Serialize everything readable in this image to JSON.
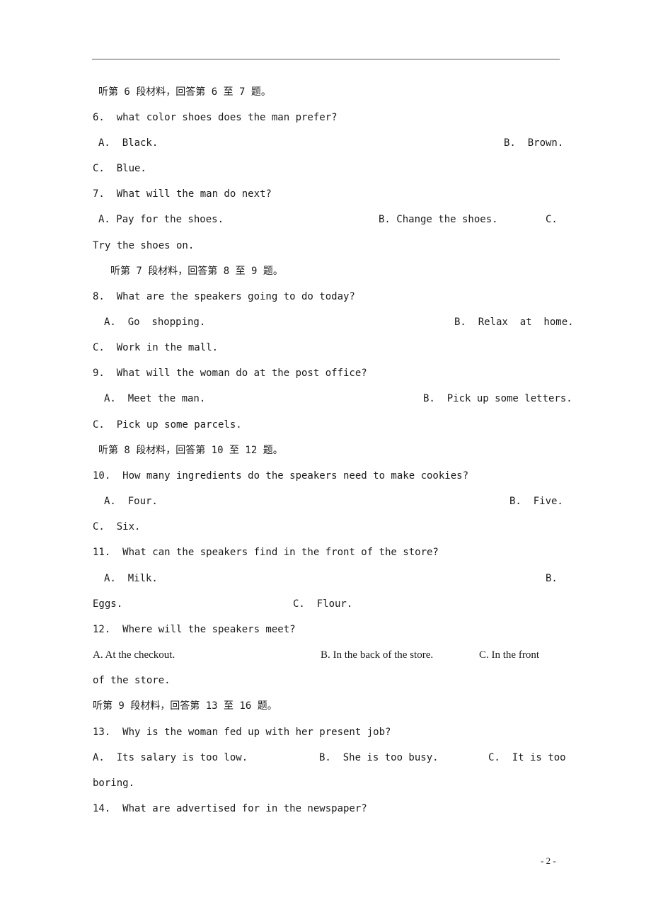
{
  "page": {
    "page_number": "- 2 -",
    "lines": [
      {
        "text": "听第 6 段材料，回答第 6 至 7 题。"
      },
      {
        "text": "6.  what color shoes does the man prefer?"
      },
      {
        "text": "A.  Black."
      },
      {
        "text": "B.  Brown."
      },
      {
        "text": "C.  Blue."
      },
      {
        "text": "7.  What will the man do next?"
      },
      {
        "text": "A. Pay for the shoes."
      },
      {
        "text": "B. Change the shoes."
      },
      {
        "text": "C."
      },
      {
        "text": "Try the shoes on."
      },
      {
        "text": "听第 7 段材料，回答第 8 至 9 题。"
      },
      {
        "text": "8.  What are the speakers going to do today?"
      },
      {
        "text": "A.  Go  shopping."
      },
      {
        "text": "B.  Relax  at  home."
      },
      {
        "text": "C.  Work in the mall."
      },
      {
        "text": "9.  What will the woman do at the post office?"
      },
      {
        "text": "A.  Meet the man."
      },
      {
        "text": "B.  Pick up some letters."
      },
      {
        "text": "C.  Pick up some parcels."
      },
      {
        "text": "听第 8 段材料，回答第 10 至 12 题。"
      },
      {
        "text": "10.  How many ingredients do the speakers need to make cookies?"
      },
      {
        "text": "A.  Four."
      },
      {
        "text": "B.  Five."
      },
      {
        "text": "C.  Six."
      },
      {
        "text": "11.  What can the speakers find in the front of the store?"
      },
      {
        "text": "A.  Milk."
      },
      {
        "text": "B."
      },
      {
        "text": "Eggs."
      },
      {
        "text": "C.  Flour."
      },
      {
        "text": "12.  Where will the speakers meet?"
      },
      {
        "text": "A. At the checkout."
      },
      {
        "text": "B. In the back of the store."
      },
      {
        "text": "C. In the front"
      },
      {
        "text": "of the store."
      },
      {
        "text": "听第 9 段材料，回答第 13 至 16 题。"
      },
      {
        "text": "13.  Why is the woman fed up with her present job?"
      },
      {
        "text": "A.  Its salary is too low."
      },
      {
        "text": "B.  She is too busy."
      },
      {
        "text": "C.  It is too"
      },
      {
        "text": "boring."
      },
      {
        "text": "14.  What are advertised for in the newspaper?"
      }
    ]
  }
}
